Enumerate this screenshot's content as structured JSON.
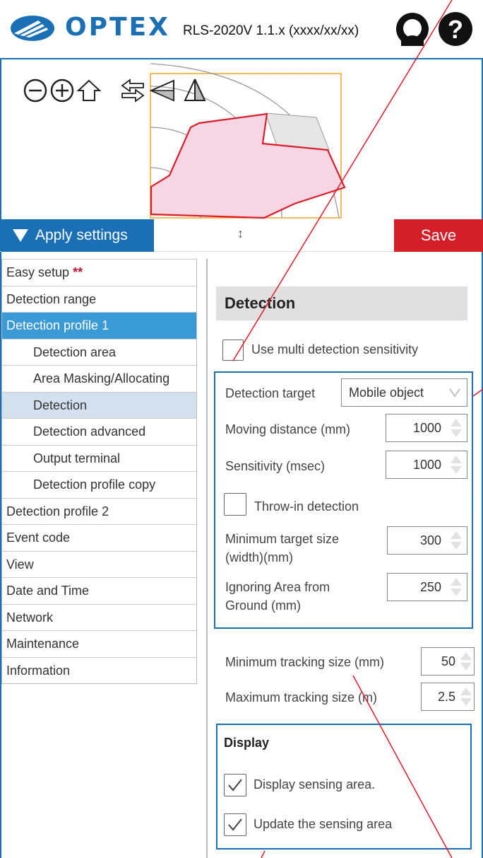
{
  "header": {
    "logo_text": "OPTEX",
    "version": "RLS-2020V 1.1.x (xxxx/xx/xx)",
    "icons": [
      "user-icon",
      "help-icon"
    ]
  },
  "viewer_tools": [
    "zoom-out-icon",
    "zoom-in-icon",
    "home-icon",
    "swap-icon",
    "flip-left-icon",
    "mirror-icon"
  ],
  "toolbar": {
    "apply_label": "Apply settings",
    "resize_glyph": "↕",
    "save_label": "Save"
  },
  "sidebar": {
    "items": [
      {
        "label": "Easy setup",
        "suffix": "**"
      },
      {
        "label": "Detection range"
      },
      {
        "label": "Detection profile 1"
      },
      {
        "label": "Detection area"
      },
      {
        "label": "Area Masking/Allocating"
      },
      {
        "label": "Detection"
      },
      {
        "label": "Detection advanced"
      },
      {
        "label": "Output terminal"
      },
      {
        "label": "Detection profile copy"
      },
      {
        "label": "Detection profile 2"
      },
      {
        "label": "Event code"
      },
      {
        "label": "View"
      },
      {
        "label": "Date and Time"
      },
      {
        "label": "Network"
      },
      {
        "label": "Maintenance"
      },
      {
        "label": "Information"
      }
    ]
  },
  "main": {
    "section_title": "Detection",
    "multi_sensitivity": {
      "label": "Use multi detection sensitivity",
      "checked": false
    },
    "detection_target": {
      "label": "Detection target",
      "value": "Mobile object"
    },
    "moving_distance": {
      "label": "Moving distance (mm)",
      "value": "1000"
    },
    "sensitivity": {
      "label": "Sensitivity (msec)",
      "value": "1000"
    },
    "throw_in": {
      "label": "Throw-in detection",
      "checked": false
    },
    "min_target_size": {
      "label_line1": "Minimum target size",
      "label_line2": "(width)(mm)",
      "value": "300"
    },
    "ignoring_area": {
      "label_line1": "Ignoring Area from",
      "label_line2": "Ground (mm)",
      "value": "250"
    },
    "min_tracking": {
      "label": "Minimum tracking size (mm)",
      "value": "50"
    },
    "max_tracking": {
      "label": "Maximum tracking size (m)",
      "value": "2.5"
    },
    "display": {
      "title": "Display",
      "sensing_area": {
        "label": "Display sensing area.",
        "checked": true
      },
      "update_area": {
        "label": "Update the sensing area",
        "checked": true
      }
    }
  },
  "colors": {
    "brand_blue": "#1a6fb5",
    "save_red": "#d41f28",
    "active_nav": "#3a9ad6",
    "current_nav": "#d3e1ee",
    "area_fill": "#f6d6e2",
    "area_stroke": "#dd1b2a",
    "frame_orange": "#f3a42a"
  }
}
